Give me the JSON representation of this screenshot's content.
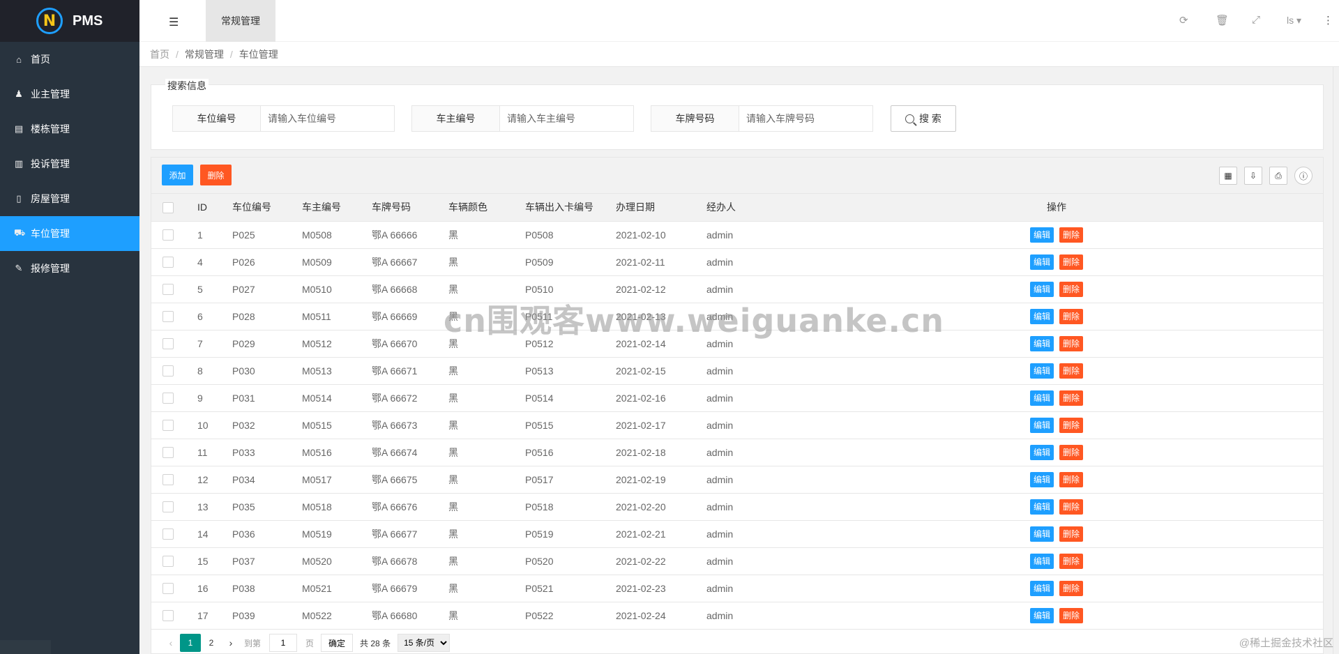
{
  "app": {
    "logo_letter": "N",
    "name": "PMS"
  },
  "sidebar": {
    "items": [
      {
        "label": "首页",
        "icon": "home-icon",
        "glyph": "⌂",
        "active": false
      },
      {
        "label": "业主管理",
        "icon": "person-icon",
        "glyph": "♟",
        "active": false
      },
      {
        "label": "楼栋管理",
        "icon": "building-icon",
        "glyph": "▤",
        "active": false
      },
      {
        "label": "投诉管理",
        "icon": "document-icon",
        "glyph": "▥",
        "active": false
      },
      {
        "label": "房屋管理",
        "icon": "house-icon",
        "glyph": "▯",
        "active": false
      },
      {
        "label": "车位管理",
        "icon": "car-icon",
        "glyph": "⛟",
        "active": true
      },
      {
        "label": "报修管理",
        "icon": "wrench-icon",
        "glyph": "✎",
        "active": false
      }
    ]
  },
  "header": {
    "active_tab": "常规管理",
    "user": "ls",
    "icons": [
      "refresh-icon",
      "trash-icon",
      "fullscreen-icon",
      "more-icon"
    ]
  },
  "breadcrumb": [
    "首页",
    "常规管理",
    "车位管理"
  ],
  "search": {
    "legend": "搜索信息",
    "fields": [
      {
        "label": "车位编号",
        "placeholder": "请输入车位编号"
      },
      {
        "label": "车主编号",
        "placeholder": "请输入车主编号"
      },
      {
        "label": "车牌号码",
        "placeholder": "请输入车牌号码"
      }
    ],
    "button": "搜 索"
  },
  "toolbar": {
    "add": "添加",
    "delete": "删除"
  },
  "table": {
    "columns": [
      "ID",
      "车位编号",
      "车主编号",
      "车牌号码",
      "车辆颜色",
      "车辆出入卡编号",
      "办理日期",
      "经办人",
      "操作"
    ],
    "edit_label": "编辑",
    "delete_label": "删除",
    "rows": [
      [
        "1",
        "P025",
        "M0508",
        "鄂A 66666",
        "黑",
        "P0508",
        "2021-02-10",
        "admin"
      ],
      [
        "4",
        "P026",
        "M0509",
        "鄂A 66667",
        "黑",
        "P0509",
        "2021-02-11",
        "admin"
      ],
      [
        "5",
        "P027",
        "M0510",
        "鄂A 66668",
        "黑",
        "P0510",
        "2021-02-12",
        "admin"
      ],
      [
        "6",
        "P028",
        "M0511",
        "鄂A 66669",
        "黑",
        "P0511",
        "2021-02-13",
        "admin"
      ],
      [
        "7",
        "P029",
        "M0512",
        "鄂A 66670",
        "黑",
        "P0512",
        "2021-02-14",
        "admin"
      ],
      [
        "8",
        "P030",
        "M0513",
        "鄂A 66671",
        "黑",
        "P0513",
        "2021-02-15",
        "admin"
      ],
      [
        "9",
        "P031",
        "M0514",
        "鄂A 66672",
        "黑",
        "P0514",
        "2021-02-16",
        "admin"
      ],
      [
        "10",
        "P032",
        "M0515",
        "鄂A 66673",
        "黑",
        "P0515",
        "2021-02-17",
        "admin"
      ],
      [
        "11",
        "P033",
        "M0516",
        "鄂A 66674",
        "黑",
        "P0516",
        "2021-02-18",
        "admin"
      ],
      [
        "12",
        "P034",
        "M0517",
        "鄂A 66675",
        "黑",
        "P0517",
        "2021-02-19",
        "admin"
      ],
      [
        "13",
        "P035",
        "M0518",
        "鄂A 66676",
        "黑",
        "P0518",
        "2021-02-20",
        "admin"
      ],
      [
        "14",
        "P036",
        "M0519",
        "鄂A 66677",
        "黑",
        "P0519",
        "2021-02-21",
        "admin"
      ],
      [
        "15",
        "P037",
        "M0520",
        "鄂A 66678",
        "黑",
        "P0520",
        "2021-02-22",
        "admin"
      ],
      [
        "16",
        "P038",
        "M0521",
        "鄂A 66679",
        "黑",
        "P0521",
        "2021-02-23",
        "admin"
      ],
      [
        "17",
        "P039",
        "M0522",
        "鄂A 66680",
        "黑",
        "P0522",
        "2021-02-24",
        "admin"
      ]
    ]
  },
  "pagination": {
    "pages": [
      "1",
      "2"
    ],
    "current": "1",
    "goto_label": "到第",
    "goto_value": "1",
    "page_unit": "页",
    "confirm": "确定",
    "total": "共 28 条",
    "page_size": "15 条/页"
  },
  "watermark": "cn围观客www.weiguanke.cn",
  "credit": "@稀土掘金技术社区",
  "colors": {
    "primary": "#1e9fff",
    "danger": "#ff5722",
    "pager_active": "#009688",
    "sidebar_bg": "#28333e"
  }
}
